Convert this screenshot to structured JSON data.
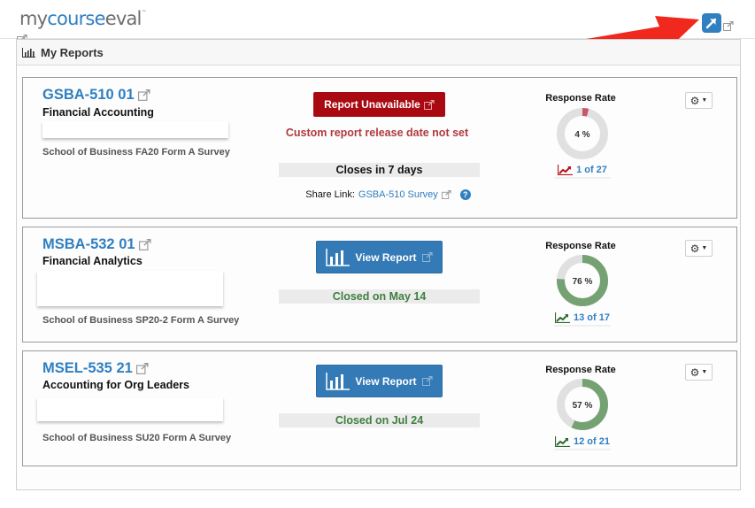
{
  "header": {
    "logo_prefix": "my",
    "logo_accent": "course",
    "logo_suffix": "eval",
    "logo_tm": "™"
  },
  "panel": {
    "title": "My Reports"
  },
  "colors": {
    "brand_blue": "#2f7fc1",
    "danger_red": "#a90a12",
    "success_green": "#3f7e3f",
    "donut_low": "#c9566a",
    "donut_ok": "#76a173",
    "donut_track": "#e0e0e0"
  },
  "reports": [
    {
      "code": "GSBA-510 01",
      "name": "Financial Accounting",
      "survey": "School of Business FA20 Form A Survey",
      "button_label": "Report Unavailable",
      "button_type": "unavailable",
      "warning": "Custom report release date not set",
      "status": "Closes in 7 days",
      "share_label": "Share Link:",
      "share_link": "GSBA-510 Survey",
      "rr_title": "Response Rate",
      "rr_percent": 4,
      "rr_percent_label": "4 %",
      "rr_count": "1 of 27"
    },
    {
      "code": "MSBA-532 01",
      "name": "Financial Analytics",
      "survey": "School of Business SP20-2 Form A Survey",
      "button_label": "View Report",
      "button_type": "view",
      "status": "Closed on May 14",
      "rr_title": "Response Rate",
      "rr_percent": 76,
      "rr_percent_label": "76 %",
      "rr_count": "13 of 17"
    },
    {
      "code": "MSEL-535 21",
      "name": "Accounting for Org Leaders",
      "survey": "School of Business SU20 Form A Survey",
      "button_label": "View Report",
      "button_type": "view",
      "status": "Closed on Jul 24",
      "rr_title": "Response Rate",
      "rr_percent": 57,
      "rr_percent_label": "57 %",
      "rr_count": "12 of 21"
    }
  ]
}
